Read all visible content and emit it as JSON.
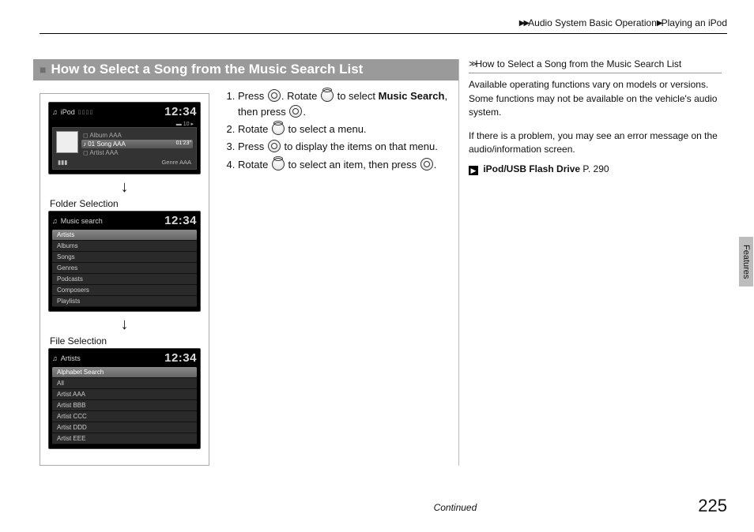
{
  "breadcrumb": {
    "section": "Audio System Basic Operation",
    "sub": "Playing an iPod"
  },
  "title": "How to Select a Song from the Music Search List",
  "steps": [
    {
      "pre": "Press ",
      "icon1": "knob-btn",
      "mid1": ". Rotate ",
      "icon2": "knob-ring",
      "mid2": " to select ",
      "bold": "Music Search",
      "post": ", then press ",
      "icon3": "knob-btn",
      "end": "."
    },
    {
      "pre": "Rotate ",
      "icon1": "knob-ring",
      "post": " to select a menu."
    },
    {
      "pre": "Press ",
      "icon1": "knob-btn",
      "post": " to display the items on that menu."
    },
    {
      "pre": "Rotate ",
      "icon1": "knob-ring",
      "mid1": " to select an item, then press ",
      "icon2": "knob-btn",
      "post": "."
    }
  ],
  "screen1": {
    "source": "iPod",
    "clock": "12:34",
    "album": "Album AAA",
    "track_hl": "01 Song AAA",
    "time": "01'23\"",
    "artist": "Artist AAA",
    "genre": "Genre AAA",
    "count": "10"
  },
  "caption1": "Folder Selection",
  "screen2": {
    "title": "Music search",
    "clock": "12:34",
    "items": [
      "Artists",
      "Albums",
      "Songs",
      "Genres",
      "Podcasts",
      "Composers",
      "Playlists"
    ],
    "selected": 0
  },
  "caption2": "File Selection",
  "screen3": {
    "title": "Artists",
    "clock": "12:34",
    "items": [
      "Alphabet Search",
      "All",
      "Artist AAA",
      "Artist BBB",
      "Artist CCC",
      "Artist DDD",
      "Artist EEE"
    ],
    "selected": 0
  },
  "side": {
    "heading": "How to Select a Song from the Music Search List",
    "para1": "Available operating functions vary on models or versions. Some functions may not be available on the vehicle's audio system.",
    "para2": "If there is a problem, you may see an error message on the audio/information screen.",
    "ref_bold": "iPod/USB Flash Drive",
    "ref_page": "P. 290"
  },
  "tab": "Features",
  "continued": "Continued",
  "pagenum": "225"
}
